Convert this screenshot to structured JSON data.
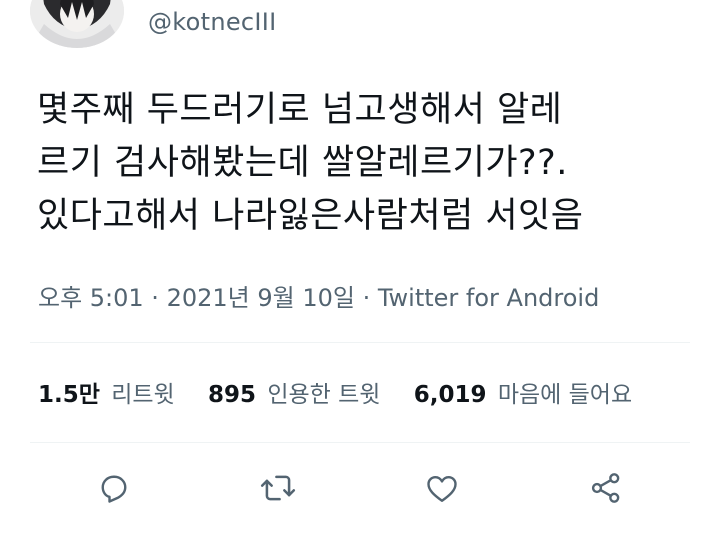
{
  "author": {
    "handle": "@kotnecIII"
  },
  "tweet": {
    "lines": [
      "몇주째 두드러기로 넘고생해서 알레",
      "르기 검사해봤는데 쌀알레르기가??.",
      "있다고해서 나라잃은사람처럼 서잇음"
    ]
  },
  "meta": {
    "text": "오후 5:01 · 2021년 9월 10일 · Twitter for Android"
  },
  "stats": [
    {
      "value": "1.5만",
      "label": "리트윗"
    },
    {
      "value": "895",
      "label": "인용한 트윗"
    },
    {
      "value": "6,019",
      "label": "마음에 들어요"
    }
  ],
  "actions": [
    {
      "icon": "reply-icon"
    },
    {
      "icon": "retweet-icon"
    },
    {
      "icon": "like-icon"
    },
    {
      "icon": "share-icon"
    }
  ],
  "colors": {
    "text": "#0f1419",
    "secondary": "#536471",
    "divider": "#eff3f4"
  }
}
